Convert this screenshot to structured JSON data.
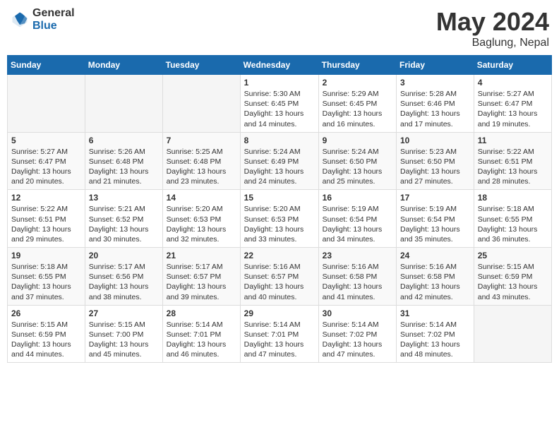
{
  "logo": {
    "general": "General",
    "blue": "Blue"
  },
  "header": {
    "title": "May 2024",
    "subtitle": "Baglung, Nepal"
  },
  "weekdays": [
    "Sunday",
    "Monday",
    "Tuesday",
    "Wednesday",
    "Thursday",
    "Friday",
    "Saturday"
  ],
  "weeks": [
    [
      {
        "day": "",
        "info": ""
      },
      {
        "day": "",
        "info": ""
      },
      {
        "day": "",
        "info": ""
      },
      {
        "day": "1",
        "info": "Sunrise: 5:30 AM\nSunset: 6:45 PM\nDaylight: 13 hours\nand 14 minutes."
      },
      {
        "day": "2",
        "info": "Sunrise: 5:29 AM\nSunset: 6:45 PM\nDaylight: 13 hours\nand 16 minutes."
      },
      {
        "day": "3",
        "info": "Sunrise: 5:28 AM\nSunset: 6:46 PM\nDaylight: 13 hours\nand 17 minutes."
      },
      {
        "day": "4",
        "info": "Sunrise: 5:27 AM\nSunset: 6:47 PM\nDaylight: 13 hours\nand 19 minutes."
      }
    ],
    [
      {
        "day": "5",
        "info": "Sunrise: 5:27 AM\nSunset: 6:47 PM\nDaylight: 13 hours\nand 20 minutes."
      },
      {
        "day": "6",
        "info": "Sunrise: 5:26 AM\nSunset: 6:48 PM\nDaylight: 13 hours\nand 21 minutes."
      },
      {
        "day": "7",
        "info": "Sunrise: 5:25 AM\nSunset: 6:48 PM\nDaylight: 13 hours\nand 23 minutes."
      },
      {
        "day": "8",
        "info": "Sunrise: 5:24 AM\nSunset: 6:49 PM\nDaylight: 13 hours\nand 24 minutes."
      },
      {
        "day": "9",
        "info": "Sunrise: 5:24 AM\nSunset: 6:50 PM\nDaylight: 13 hours\nand 25 minutes."
      },
      {
        "day": "10",
        "info": "Sunrise: 5:23 AM\nSunset: 6:50 PM\nDaylight: 13 hours\nand 27 minutes."
      },
      {
        "day": "11",
        "info": "Sunrise: 5:22 AM\nSunset: 6:51 PM\nDaylight: 13 hours\nand 28 minutes."
      }
    ],
    [
      {
        "day": "12",
        "info": "Sunrise: 5:22 AM\nSunset: 6:51 PM\nDaylight: 13 hours\nand 29 minutes."
      },
      {
        "day": "13",
        "info": "Sunrise: 5:21 AM\nSunset: 6:52 PM\nDaylight: 13 hours\nand 30 minutes."
      },
      {
        "day": "14",
        "info": "Sunrise: 5:20 AM\nSunset: 6:53 PM\nDaylight: 13 hours\nand 32 minutes."
      },
      {
        "day": "15",
        "info": "Sunrise: 5:20 AM\nSunset: 6:53 PM\nDaylight: 13 hours\nand 33 minutes."
      },
      {
        "day": "16",
        "info": "Sunrise: 5:19 AM\nSunset: 6:54 PM\nDaylight: 13 hours\nand 34 minutes."
      },
      {
        "day": "17",
        "info": "Sunrise: 5:19 AM\nSunset: 6:54 PM\nDaylight: 13 hours\nand 35 minutes."
      },
      {
        "day": "18",
        "info": "Sunrise: 5:18 AM\nSunset: 6:55 PM\nDaylight: 13 hours\nand 36 minutes."
      }
    ],
    [
      {
        "day": "19",
        "info": "Sunrise: 5:18 AM\nSunset: 6:55 PM\nDaylight: 13 hours\nand 37 minutes."
      },
      {
        "day": "20",
        "info": "Sunrise: 5:17 AM\nSunset: 6:56 PM\nDaylight: 13 hours\nand 38 minutes."
      },
      {
        "day": "21",
        "info": "Sunrise: 5:17 AM\nSunset: 6:57 PM\nDaylight: 13 hours\nand 39 minutes."
      },
      {
        "day": "22",
        "info": "Sunrise: 5:16 AM\nSunset: 6:57 PM\nDaylight: 13 hours\nand 40 minutes."
      },
      {
        "day": "23",
        "info": "Sunrise: 5:16 AM\nSunset: 6:58 PM\nDaylight: 13 hours\nand 41 minutes."
      },
      {
        "day": "24",
        "info": "Sunrise: 5:16 AM\nSunset: 6:58 PM\nDaylight: 13 hours\nand 42 minutes."
      },
      {
        "day": "25",
        "info": "Sunrise: 5:15 AM\nSunset: 6:59 PM\nDaylight: 13 hours\nand 43 minutes."
      }
    ],
    [
      {
        "day": "26",
        "info": "Sunrise: 5:15 AM\nSunset: 6:59 PM\nDaylight: 13 hours\nand 44 minutes."
      },
      {
        "day": "27",
        "info": "Sunrise: 5:15 AM\nSunset: 7:00 PM\nDaylight: 13 hours\nand 45 minutes."
      },
      {
        "day": "28",
        "info": "Sunrise: 5:14 AM\nSunset: 7:01 PM\nDaylight: 13 hours\nand 46 minutes."
      },
      {
        "day": "29",
        "info": "Sunrise: 5:14 AM\nSunset: 7:01 PM\nDaylight: 13 hours\nand 47 minutes."
      },
      {
        "day": "30",
        "info": "Sunrise: 5:14 AM\nSunset: 7:02 PM\nDaylight: 13 hours\nand 47 minutes."
      },
      {
        "day": "31",
        "info": "Sunrise: 5:14 AM\nSunset: 7:02 PM\nDaylight: 13 hours\nand 48 minutes."
      },
      {
        "day": "",
        "info": ""
      }
    ]
  ]
}
